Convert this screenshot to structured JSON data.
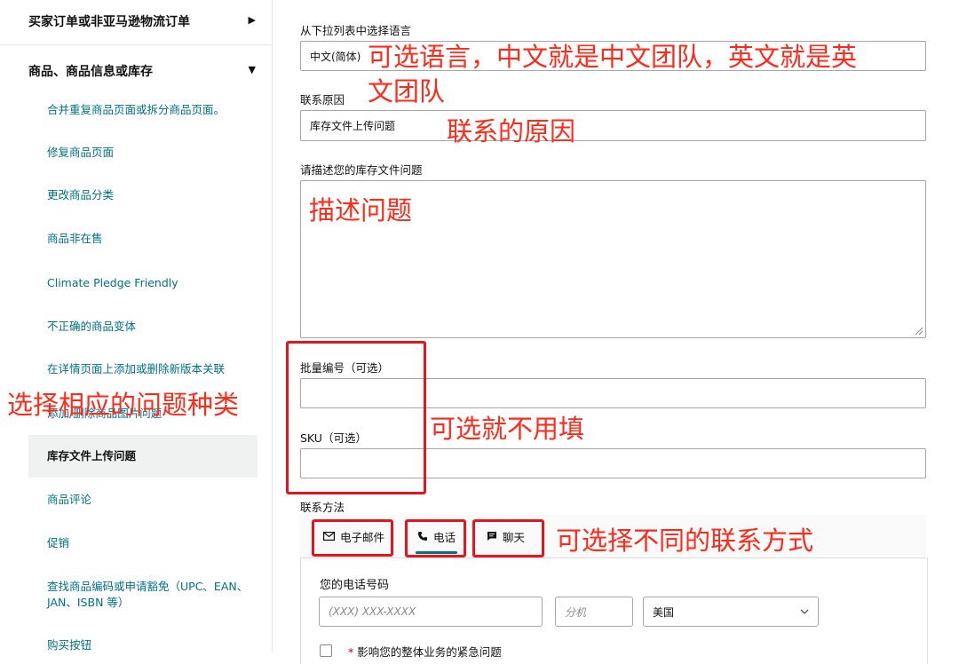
{
  "sidebar": {
    "section1": {
      "title": "买家订单或非亚马逊物流订单",
      "caret": "▶"
    },
    "section2": {
      "title": "商品、商品信息或库存",
      "caret": "▼"
    },
    "items": [
      "合并重复商品页面或拆分商品页面。",
      "修复商品页面",
      "更改商品分类",
      "商品非在售",
      "Climate Pledge Friendly",
      "不正确的商品变体",
      "在详情页面上添加或删除新版本关联",
      "添加/删除商品图片问题",
      "库存文件上传问题",
      "商品评论",
      "促销",
      "查找商品编码或申请豁免（UPC、EAN、JAN、ISBN 等）",
      "购买按钮"
    ],
    "active_index": 8
  },
  "form": {
    "language_label": "从下拉列表中选择语言",
    "language_value": "中文(简体)",
    "reason_label": "联系原因",
    "reason_value": "库存文件上传问题",
    "describe_label": "请描述您的库存文件问题",
    "batch_label": "批量编号（可选）",
    "sku_label": "SKU（可选）",
    "contact_label": "联系方法",
    "tabs": [
      {
        "label": "电子邮件",
        "icon": "envelope-icon"
      },
      {
        "label": "电话",
        "icon": "phone-icon"
      },
      {
        "label": "聊天",
        "icon": "chat-icon"
      }
    ],
    "active_tab": 1,
    "phone_label": "您的电话号码",
    "phone_placeholder": "(XXX) XXX-XXXX",
    "ext_placeholder": "分机",
    "country_value": "美国",
    "urgent_text": "影响您的整体业务的紧急问题"
  },
  "annotations": {
    "language": "可选语言，中文就是中文团队，英文就是英",
    "language_2": "文团队",
    "reason": "联系的原因",
    "describe": "描述问题",
    "category": "选择相应的问题种类",
    "optional": "可选就不用填",
    "contact": "可选择不同的联系方式"
  },
  "colors": {
    "link": "#007185",
    "annotation": "#ff2a1a",
    "annotation_box": "#e8141c",
    "border": "#a6a6a6"
  }
}
